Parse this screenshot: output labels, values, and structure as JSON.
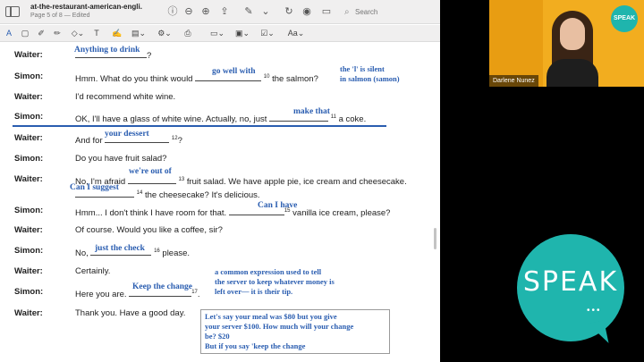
{
  "window": {
    "doc_title": "at-the-restaurant-american-engli...",
    "doc_subtitle": "Page 5 of 8 — Edited",
    "search_placeholder": "Search"
  },
  "toolbar_icons": [
    "info-icon",
    "zoom-out-icon",
    "zoom-in-icon",
    "share-icon",
    "markup-pen-icon",
    "rotate-icon",
    "highlight-icon",
    "annotate-icon"
  ],
  "markup_bar": {
    "text_tool": "A",
    "font_label": "Aa"
  },
  "dialogue": [
    {
      "speaker": "Waiter:",
      "before": "",
      "after": "?",
      "num": ""
    },
    {
      "speaker": "Simon:",
      "before": "Hmm. What do you think would",
      "after": "the salmon?",
      "num": "10"
    },
    {
      "speaker": "Waiter:",
      "before": "I'd recommend white wine.",
      "after": "",
      "num": ""
    },
    {
      "speaker": "Simon:",
      "before": "OK, I'll have a glass of white wine. Actually, no, just",
      "after": "a coke.",
      "num": "11"
    },
    {
      "speaker": "Waiter:",
      "before": "And for",
      "after": "?",
      "num": "12"
    },
    {
      "speaker": "Simon:",
      "before": "Do you have fruit salad?",
      "after": "",
      "num": ""
    },
    {
      "speaker": "Waiter:",
      "before": "No, I'm afraid",
      "after": "fruit salad. We have apple pie, ice cream and cheesecake.",
      "num": "13"
    },
    {
      "speaker": "",
      "before": "",
      "after": "the cheesecake? It's delicious.",
      "num": "14"
    },
    {
      "speaker": "Simon:",
      "before": "Hmm... I don't think I have room for that.",
      "after": "vanilla ice cream, please?",
      "num": "15"
    },
    {
      "speaker": "Waiter:",
      "before": "Of course. Would you like a coffee, sir?",
      "after": "",
      "num": ""
    },
    {
      "speaker": "Simon:",
      "before": "No,",
      "after": "please.",
      "num": "16"
    },
    {
      "speaker": "Waiter:",
      "before": "Certainly.",
      "after": "",
      "num": ""
    },
    {
      "speaker": "Simon:",
      "before": "Here you are.",
      "after": ".",
      "num": "17"
    },
    {
      "speaker": "Waiter:",
      "before": "Thank you. Have a good day.",
      "after": "",
      "num": ""
    }
  ],
  "handwritten": {
    "a9": "Anything to drink",
    "a10": "go well with",
    "a11": "make that",
    "a12": "your dessert",
    "a13": "we're out of",
    "a14": "Can I suggest",
    "a15": "Can I have",
    "a16": "just the check",
    "a17": "Keep the change",
    "salmon_note_1": "the 'l' is silent",
    "salmon_note_2": "in salmon (samon)",
    "tip_note_1": "a common expression used to tell",
    "tip_note_2": "the server to keep whatever money is",
    "tip_note_3": "left over— it is their tip.",
    "box_1": "Let's say your meal was $80 but you give",
    "box_2": "your server $100. How much will your change",
    "box_3": "be? $20",
    "box_4": "But if you say 'keep the change"
  },
  "webcam": {
    "name": "Darlene Nunez",
    "logo_text": "SPEAK"
  },
  "brand": {
    "logo_text": "SPEAK",
    "teal": "#1fb5ad",
    "annotation_blue": "#2a5db0"
  }
}
